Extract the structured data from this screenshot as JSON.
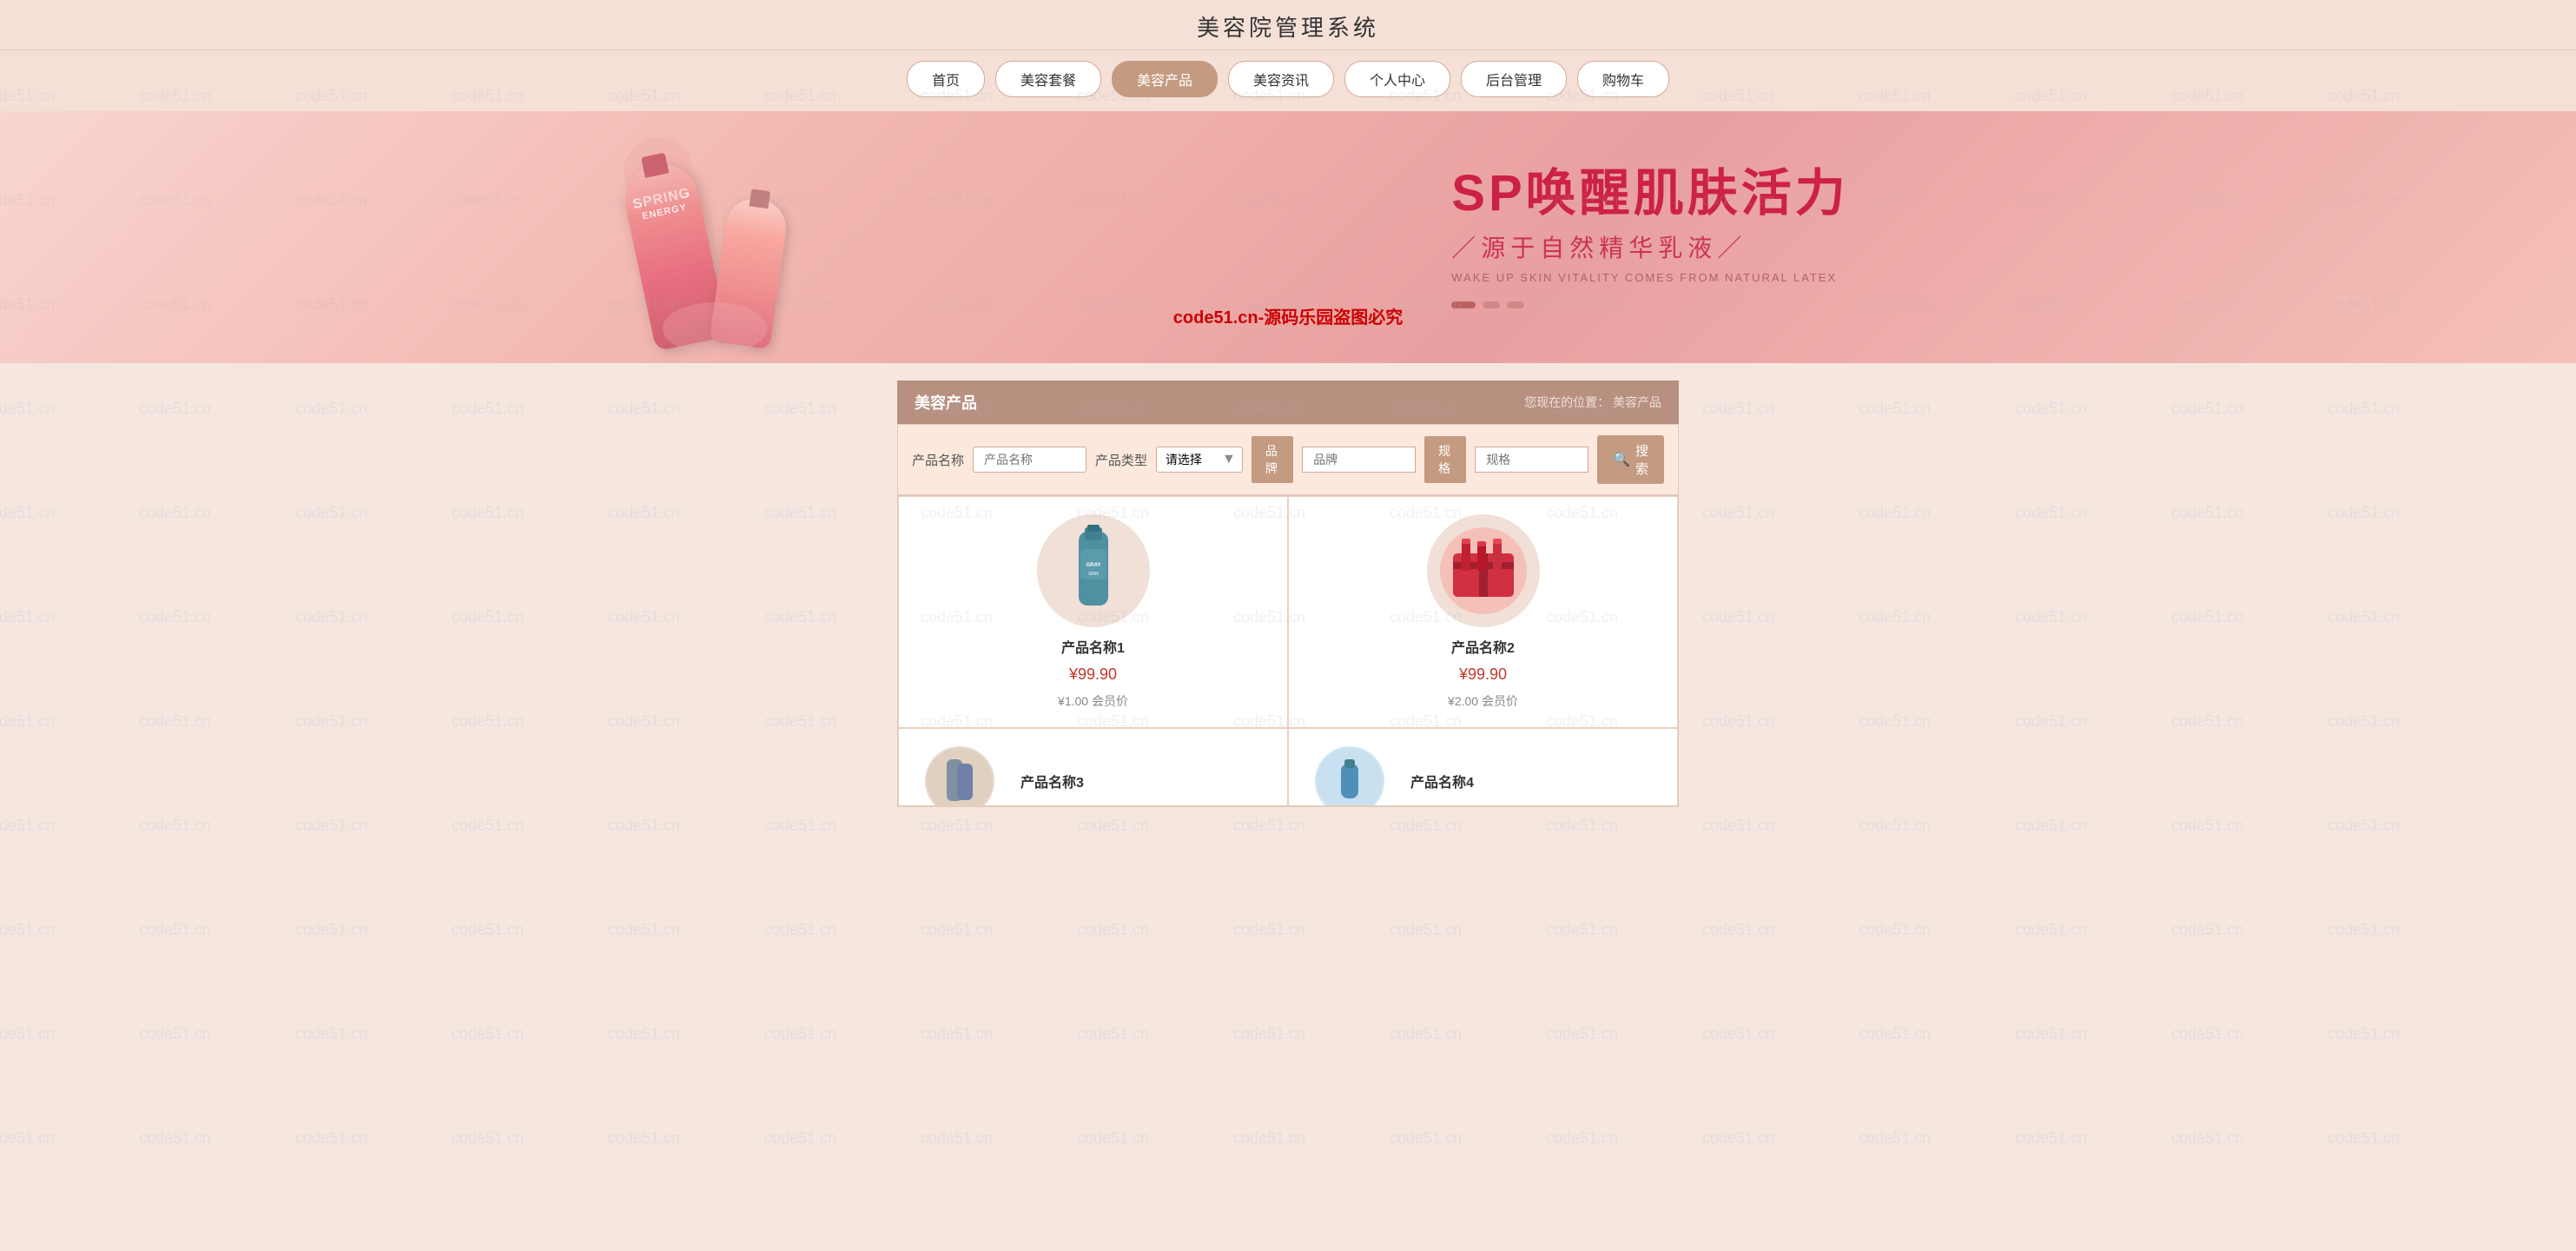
{
  "site": {
    "title": "美容院管理系统",
    "watermark": "code51.cn"
  },
  "nav": {
    "items": [
      {
        "label": "首页",
        "active": false
      },
      {
        "label": "美容套餐",
        "active": false
      },
      {
        "label": "美容产品",
        "active": true
      },
      {
        "label": "美容资讯",
        "active": false
      },
      {
        "label": "个人中心",
        "active": false
      },
      {
        "label": "后台管理",
        "active": false
      },
      {
        "label": "购物车",
        "active": false
      }
    ]
  },
  "banner": {
    "headline": "SP唤醒肌肤活力",
    "subline": "／源于自然精华乳液／",
    "english": "WAKE UP SKIN VITALITY COMES FROM NATURAL LATEX",
    "spring_text": "SPRING",
    "energy_text": "ENERGY",
    "copyright": "code51.cn-源码乐园盗图必究"
  },
  "section": {
    "title": "美容产品",
    "breadcrumb_label": "您现在的位置：",
    "breadcrumb_current": "美容产品"
  },
  "filter": {
    "product_name_label": "产品名称",
    "product_name_placeholder": "产品名称",
    "product_type_label": "产品类型",
    "product_type_placeholder": "请选择",
    "brand_label": "品牌",
    "brand_placeholder": "品牌",
    "spec_label": "规格",
    "spec_placeholder": "规格",
    "search_button": "搜索"
  },
  "products": [
    {
      "id": 1,
      "name": "产品名称1",
      "price": "¥99.90",
      "member_price": "¥1.00 会员价",
      "img_type": "teal-tube"
    },
    {
      "id": 2,
      "name": "产品名称2",
      "price": "¥99.90",
      "member_price": "¥2.00 会员价",
      "img_type": "red-set"
    },
    {
      "id": 3,
      "name": "产品名称3",
      "price": "",
      "member_price": "",
      "img_type": "partial"
    },
    {
      "id": 4,
      "name": "产品名称4",
      "price": "",
      "member_price": "",
      "img_type": "partial-blue"
    }
  ],
  "colors": {
    "nav_active": "#c49a80",
    "brand_color": "#c49a80",
    "section_header": "#b89080",
    "filter_bg": "#fde8de",
    "price_color": "#c0392b"
  }
}
